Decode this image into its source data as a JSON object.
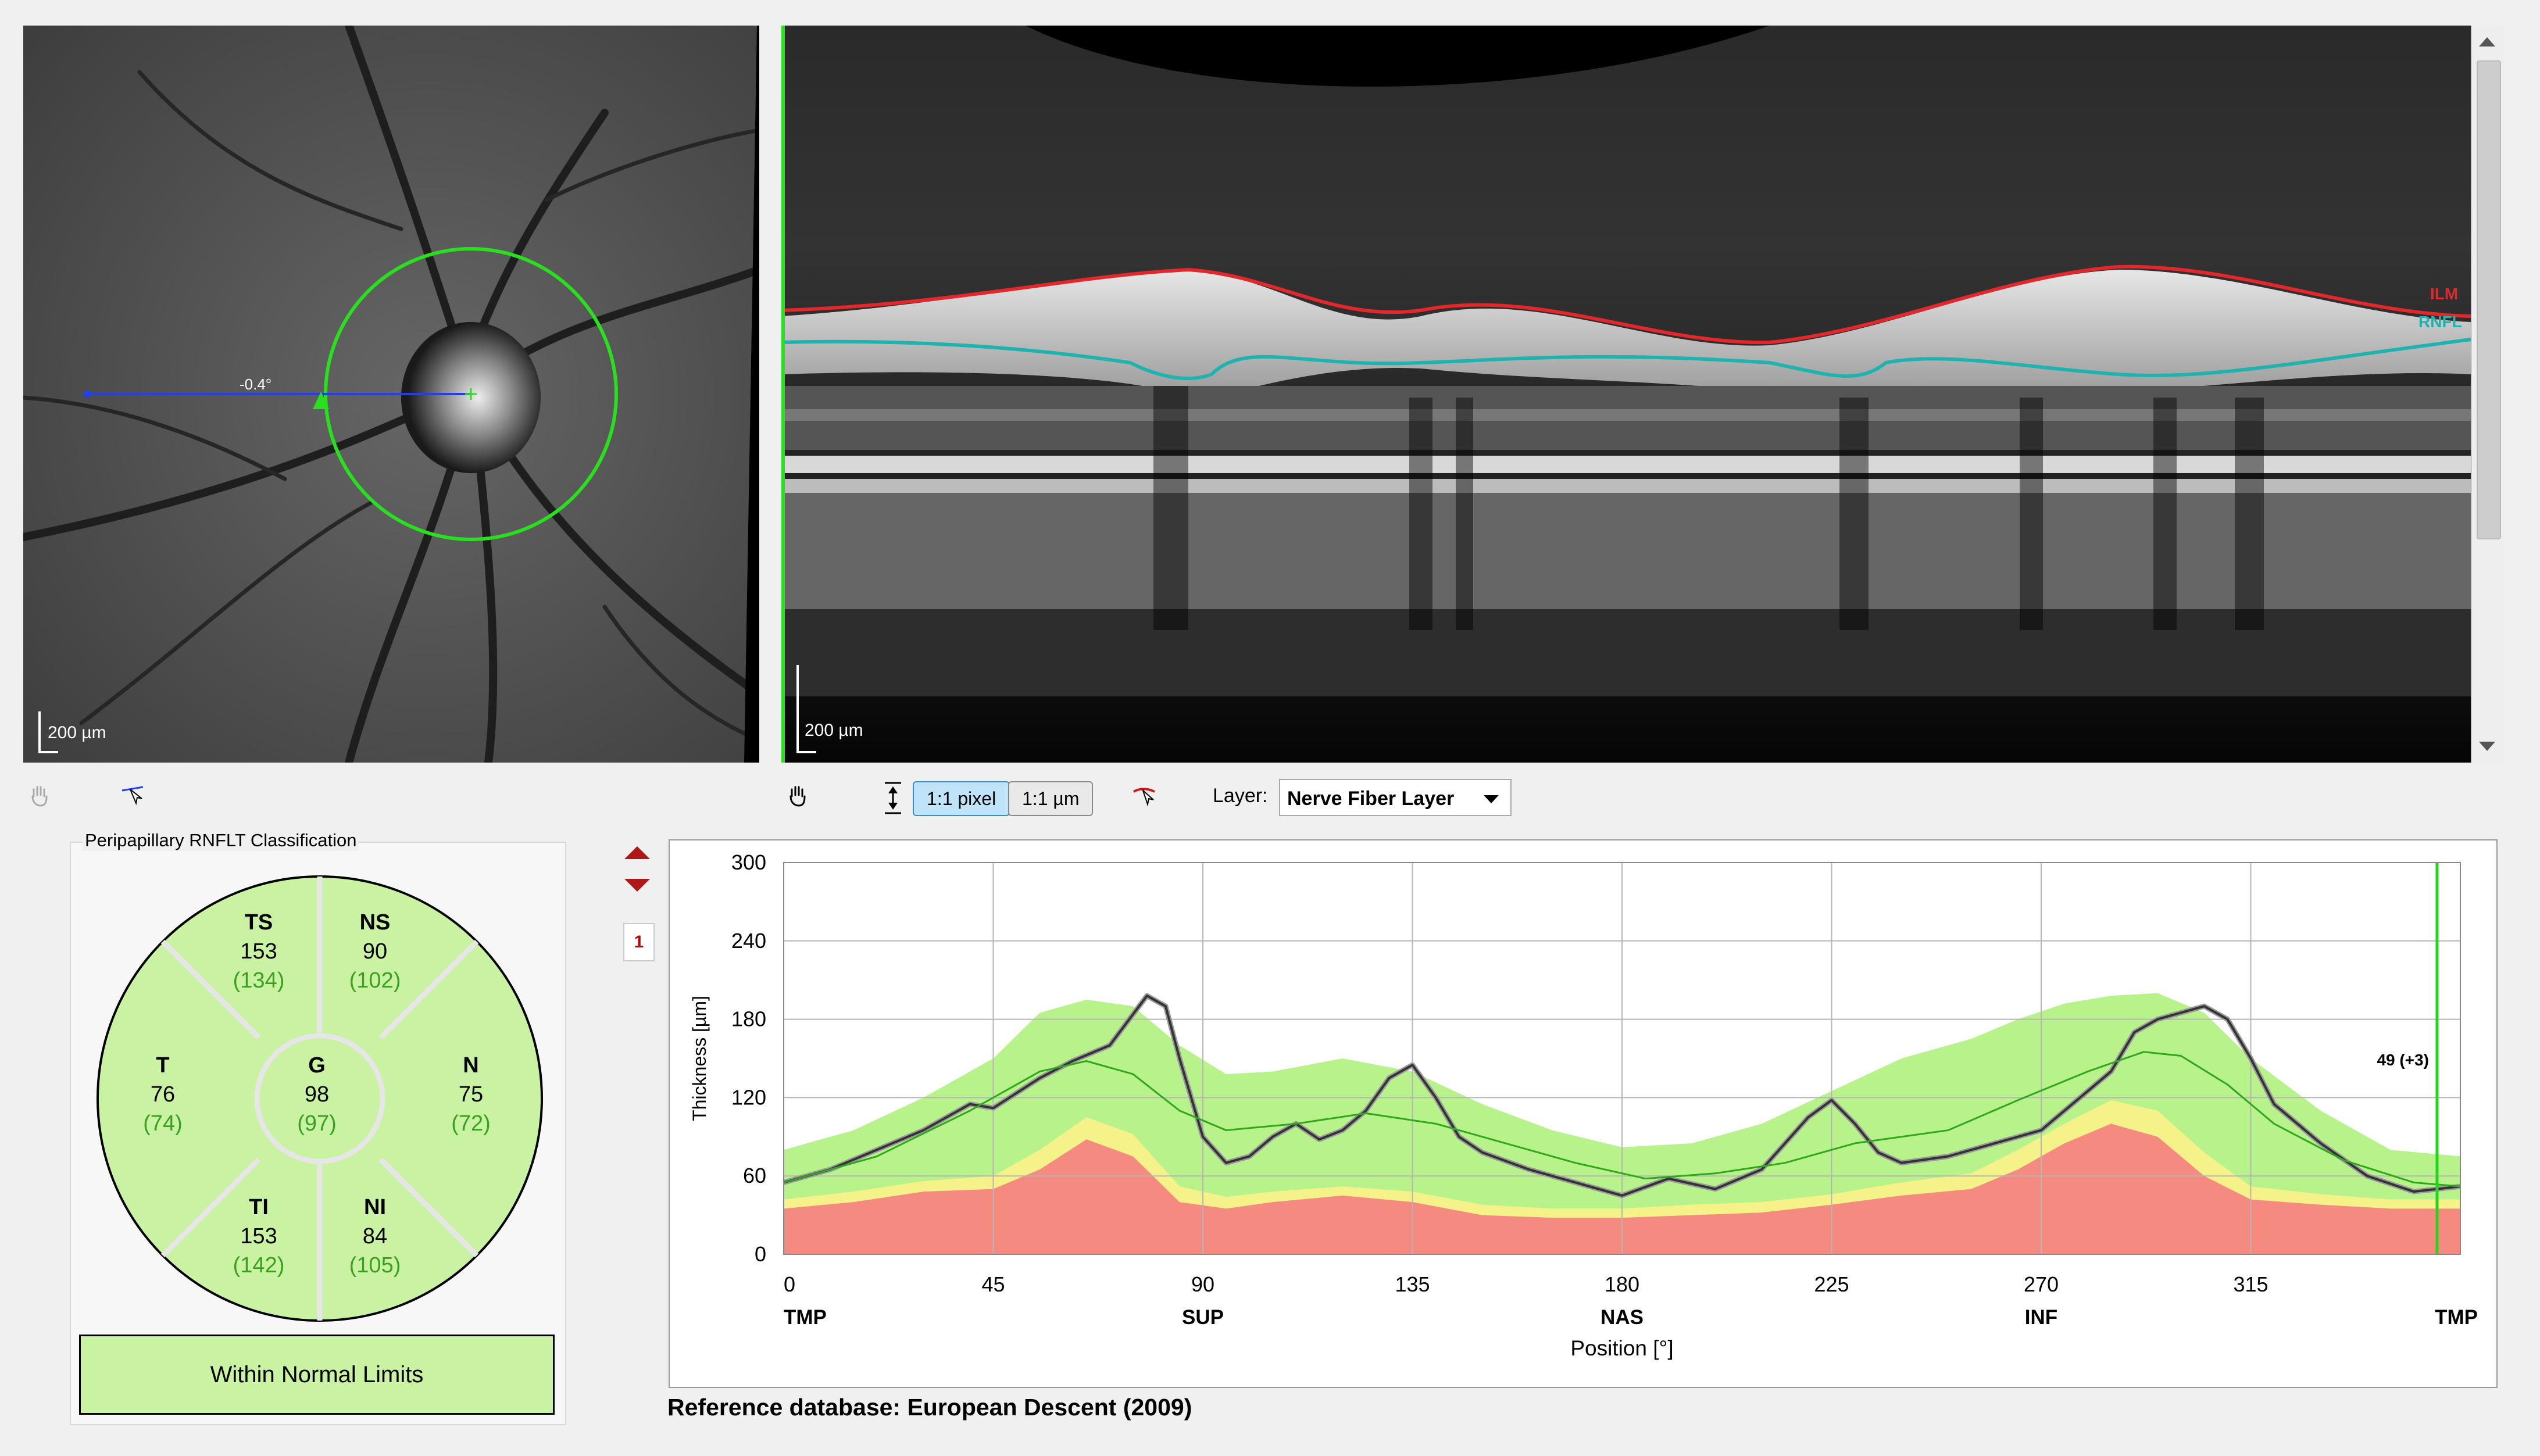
{
  "fundus": {
    "scale_label": "200 µm",
    "angle_label": "-0.4°"
  },
  "bscan": {
    "scale_label": "200 µm",
    "layer_ilm": "ILM",
    "layer_rnfl": "RNFL"
  },
  "toolbar": {
    "btn_pixel": "1:1 pixel",
    "btn_um": "1:1 µm",
    "layer_label": "Layer:",
    "layer_value": "Nerve Fiber Layer"
  },
  "classification": {
    "title": "Peripapillary RNFLT Classification",
    "sectors": {
      "TS": {
        "name": "TS",
        "value": "153",
        "ref": "(134)"
      },
      "NS": {
        "name": "NS",
        "value": "90",
        "ref": "(102)"
      },
      "T": {
        "name": "T",
        "value": "76",
        "ref": "(74)"
      },
      "G": {
        "name": "G",
        "value": "98",
        "ref": "(97)"
      },
      "N": {
        "name": "N",
        "value": "75",
        "ref": "(72)"
      },
      "TI": {
        "name": "TI",
        "value": "153",
        "ref": "(142)"
      },
      "NI": {
        "name": "NI",
        "value": "84",
        "ref": "(105)"
      }
    },
    "result": "Within Normal Limits",
    "colors": {
      "normal": "#c9f3a2",
      "value_ref": "#3aa01f"
    }
  },
  "page_button": "1",
  "reference_db": "Reference database: European Descent (2009)",
  "chart_data": {
    "type": "line",
    "ylabel": "Thickness [µm]",
    "xlabel": "Position [°]",
    "ylim": [
      0,
      300
    ],
    "xlim": [
      0,
      360
    ],
    "yticks": [
      0,
      60,
      120,
      180,
      240,
      300
    ],
    "xticks": [
      0,
      45,
      90,
      135,
      180,
      225,
      270,
      315
    ],
    "region_labels": [
      {
        "x": 0,
        "label": "TMP"
      },
      {
        "x": 90,
        "label": "SUP"
      },
      {
        "x": 180,
        "label": "NAS"
      },
      {
        "x": 270,
        "label": "INF"
      },
      {
        "x": 360,
        "label": "TMP"
      }
    ],
    "cursor": {
      "x": 355,
      "label": "49 (+3)"
    },
    "bands_x": [
      0,
      15,
      30,
      45,
      55,
      65,
      75,
      85,
      95,
      105,
      120,
      135,
      150,
      165,
      180,
      195,
      210,
      225,
      240,
      255,
      265,
      275,
      285,
      295,
      305,
      315,
      330,
      345,
      360
    ],
    "band_red_top": [
      35,
      40,
      48,
      50,
      65,
      88,
      75,
      40,
      35,
      40,
      45,
      40,
      30,
      28,
      28,
      30,
      32,
      38,
      45,
      50,
      65,
      85,
      100,
      90,
      60,
      42,
      38,
      35,
      35
    ],
    "band_yellow_top": [
      42,
      48,
      56,
      60,
      80,
      105,
      92,
      52,
      44,
      48,
      52,
      48,
      38,
      35,
      35,
      38,
      40,
      46,
      55,
      62,
      80,
      100,
      118,
      110,
      78,
      52,
      46,
      42,
      42
    ],
    "band_green_top": [
      80,
      95,
      120,
      150,
      185,
      195,
      190,
      160,
      138,
      140,
      150,
      140,
      115,
      95,
      82,
      85,
      100,
      125,
      150,
      165,
      180,
      192,
      198,
      200,
      185,
      150,
      110,
      80,
      75
    ],
    "series": [
      {
        "name": "measured",
        "color": "#333333",
        "x": [
          0,
          10,
          20,
          30,
          40,
          45,
          55,
          62,
          70,
          78,
          82,
          85,
          90,
          95,
          100,
          105,
          110,
          115,
          120,
          125,
          130,
          135,
          140,
          145,
          150,
          160,
          170,
          180,
          190,
          200,
          210,
          220,
          225,
          230,
          235,
          240,
          250,
          260,
          270,
          280,
          285,
          290,
          295,
          300,
          305,
          310,
          315,
          320,
          330,
          340,
          350,
          360
        ],
        "y": [
          55,
          65,
          80,
          95,
          115,
          112,
          135,
          148,
          160,
          198,
          190,
          150,
          90,
          70,
          75,
          90,
          100,
          88,
          95,
          110,
          135,
          145,
          120,
          90,
          78,
          65,
          55,
          45,
          58,
          50,
          65,
          105,
          118,
          100,
          78,
          70,
          75,
          85,
          95,
          125,
          140,
          170,
          180,
          185,
          190,
          180,
          150,
          115,
          85,
          60,
          48,
          52
        ]
      },
      {
        "name": "normative-mean",
        "color": "#2fa81b",
        "x": [
          0,
          20,
          40,
          55,
          65,
          75,
          85,
          95,
          110,
          125,
          140,
          155,
          170,
          185,
          200,
          215,
          230,
          250,
          265,
          280,
          292,
          300,
          310,
          320,
          335,
          350,
          360
        ],
        "y": [
          55,
          75,
          110,
          140,
          148,
          138,
          110,
          95,
          100,
          108,
          100,
          85,
          70,
          58,
          62,
          70,
          85,
          95,
          118,
          140,
          155,
          152,
          130,
          100,
          72,
          55,
          52
        ]
      }
    ]
  }
}
